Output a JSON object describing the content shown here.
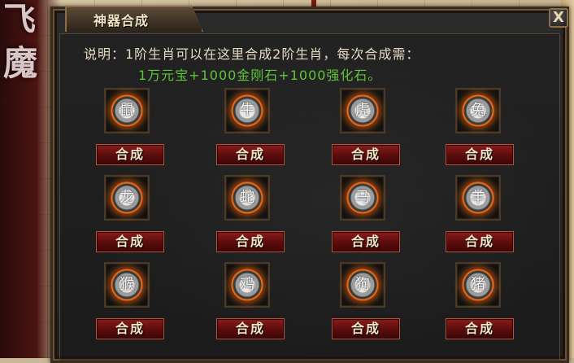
{
  "panel": {
    "title": "神器合成",
    "close_label": "X",
    "description": "说明：1阶生肖可以在这里合成2阶生肖，每次合成需：",
    "cost": "1万元宝+1000金刚石+1000强化石。"
  },
  "background": {
    "logo_line1": "飞",
    "logo_line2": "魔"
  },
  "items": [
    {
      "icon": "rat-icon",
      "glyph": "鼠",
      "button": "合成"
    },
    {
      "icon": "ox-icon",
      "glyph": "牛",
      "button": "合成"
    },
    {
      "icon": "tiger-icon",
      "glyph": "虎",
      "button": "合成"
    },
    {
      "icon": "rabbit-icon",
      "glyph": "兔",
      "button": "合成"
    },
    {
      "icon": "dragon-icon",
      "glyph": "龙",
      "button": "合成"
    },
    {
      "icon": "snake-icon",
      "glyph": "蛇",
      "button": "合成"
    },
    {
      "icon": "horse-icon",
      "glyph": "马",
      "button": "合成"
    },
    {
      "icon": "goat-icon",
      "glyph": "羊",
      "button": "合成"
    },
    {
      "icon": "monkey-icon",
      "glyph": "猴",
      "button": "合成"
    },
    {
      "icon": "rooster-icon",
      "glyph": "鸡",
      "button": "合成"
    },
    {
      "icon": "dog-icon",
      "glyph": "狗",
      "button": "合成"
    },
    {
      "icon": "pig-icon",
      "glyph": "猪",
      "button": "合成"
    }
  ],
  "colors": {
    "button_bg": "#6a1010",
    "description_text": "#e6dcc2",
    "cost_text": "#5fc43a",
    "panel_bg": "#252525"
  }
}
